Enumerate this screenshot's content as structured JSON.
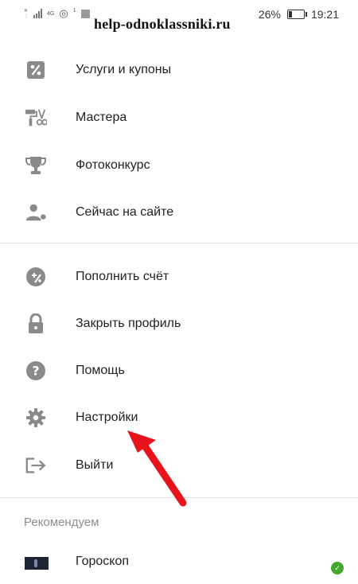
{
  "status_bar": {
    "signal_text": "4G",
    "network_badge": "1",
    "battery_percent": "26%",
    "battery_level": 0.26,
    "time": "19:21"
  },
  "watermark": "help-odnoklassniki.ru",
  "menu": {
    "group1": [
      {
        "label": "Услуги и купоны",
        "icon": "percent-icon"
      },
      {
        "label": "Мастера",
        "icon": "paint-roller-scissors-icon"
      },
      {
        "label": "Фотоконкурс",
        "icon": "trophy-icon"
      },
      {
        "label": "Сейчас на сайте",
        "icon": "user-online-icon"
      }
    ],
    "group2": [
      {
        "label": "Пополнить счёт",
        "icon": "add-money-icon"
      },
      {
        "label": "Закрыть профиль",
        "icon": "lock-icon"
      },
      {
        "label": "Помощь",
        "icon": "help-circle-icon"
      },
      {
        "label": "Настройки",
        "icon": "gear-icon"
      },
      {
        "label": "Выйти",
        "icon": "logout-icon"
      }
    ]
  },
  "recommended": {
    "title": "Рекомендуем",
    "items": [
      {
        "label": "Гороскоп",
        "icon": "horoscope-app-icon"
      }
    ]
  },
  "annotation": {
    "color": "#e8141c",
    "target": "Настройки"
  }
}
